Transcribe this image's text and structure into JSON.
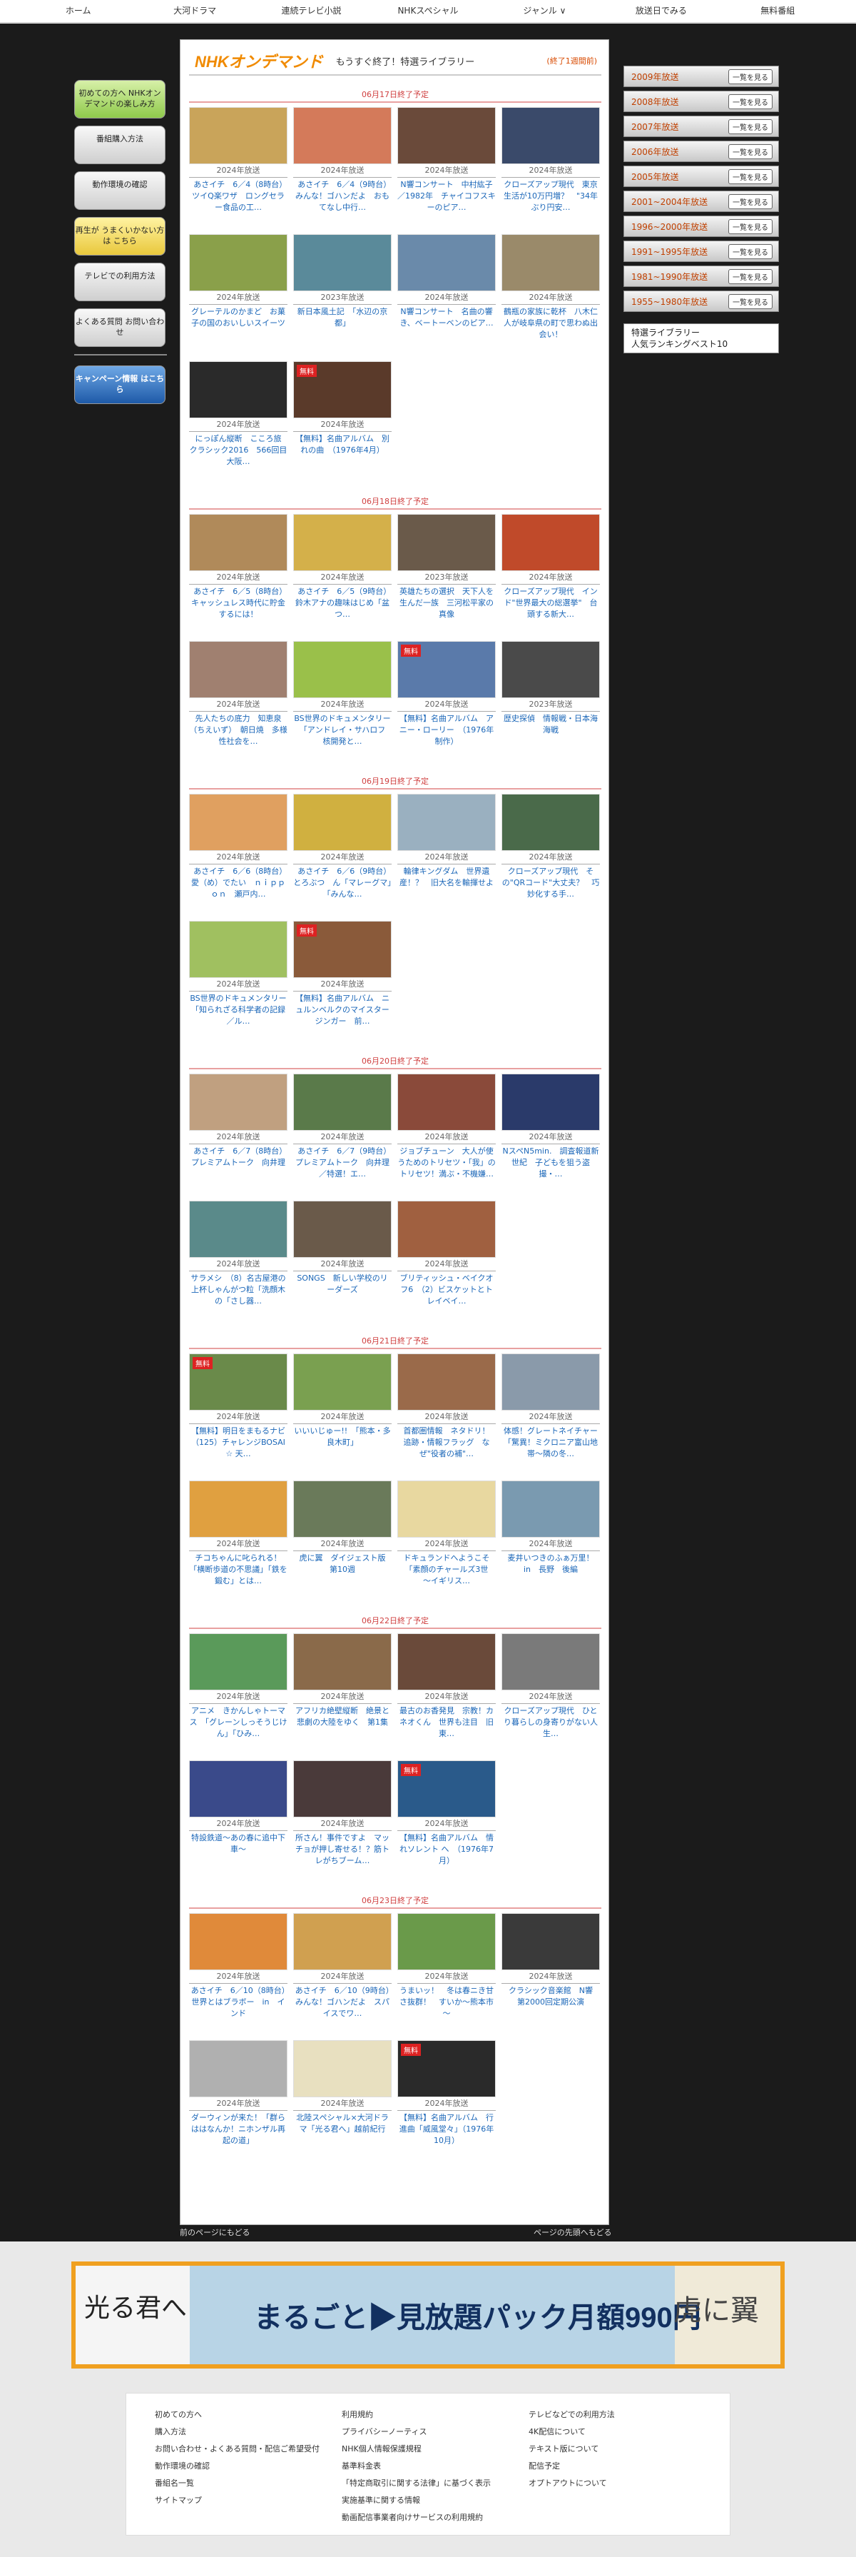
{
  "topnav": [
    "ホーム",
    "大河ドラマ",
    "連続テレビ小説",
    "NHKスペシャル",
    "ジャンル ∨",
    "放送日でみる",
    "無料番組"
  ],
  "header": {
    "logo": "NHKオンデマンド",
    "title": "もうすぐ終了！特選ライブラリー",
    "endlink": "(終了1週間前)"
  },
  "leftnav": [
    "初めての方へ NHKオンデマンドの楽しみ方",
    "番組購入方法",
    "動作環境の確認",
    "再生が うまくいかない方は こちら",
    "テレビでの利用方法",
    "よくある質問 お問い合わせ",
    "キャンペーン情報 はこちら"
  ],
  "sections": [
    {
      "label": "06月17日終了予定",
      "tiles": [
        {
          "year": "2024年放送",
          "title": "あさイチ　6／4（8時台）　ツイQ楽ワザ　ロングセラー食品の工…",
          "color": "#c9a45a"
        },
        {
          "year": "2024年放送",
          "title": "あさイチ　6／4（9時台）　みんな！ゴハンだよ　おもてなし中行…",
          "color": "#d47a5a"
        },
        {
          "year": "2024年放送",
          "title": "N響コンサート　中村紘子／1982年　チャイコフスキーのピア…",
          "color": "#6a4a3a"
        },
        {
          "year": "2024年放送",
          "title": "クローズアップ現代　東京生活が10万円増？　\"34年ぶり円安…",
          "color": "#3a4a6a"
        },
        {
          "year": "2024年放送",
          "title": "グレーテルのかまど　お菓子の国のおいしいスイーツ",
          "color": "#8aa04a"
        },
        {
          "year": "2023年放送",
          "title": "新日本風土記　「水辺の京都」",
          "color": "#5a8a9a"
        },
        {
          "year": "2024年放送",
          "title": "N響コンサート　名曲の響き、ベートーベンのピア…",
          "color": "#6a8aaa"
        },
        {
          "year": "2024年放送",
          "title": "鶴瓶の家族に乾杯　八木仁人が岐阜県の町で思わぬ出会い！",
          "color": "#9a8a6a"
        },
        {
          "year": "2024年放送",
          "title": "にっぽん縦断　こころ旅　クラシック2016　566回目　大阪…",
          "color": "#2a2a2a"
        },
        {
          "year": "2024年放送",
          "title": "【無料】名曲アルバム　別れの曲　（1976年4月）",
          "color": "#5a3a2a"
        }
      ]
    },
    {
      "label": "06月18日終了予定",
      "tiles": [
        {
          "year": "2024年放送",
          "title": "あさイチ　6／5（8時台）　キャッシュレス時代に貯金するには！",
          "color": "#b08a5a"
        },
        {
          "year": "2024年放送",
          "title": "あさイチ　6／5（9時台）　鈴木アナの趣味はじめ「盆つ…",
          "color": "#d4b04a"
        },
        {
          "year": "2023年放送",
          "title": "英雄たちの選択　天下人を生んだ一族　三河松平家の真像",
          "color": "#6a5a4a"
        },
        {
          "year": "2024年放送",
          "title": "クローズアップ現代　インド\"世界最大の総選挙\"　台頭する新大…",
          "color": "#c04a2a"
        },
        {
          "year": "2024年放送",
          "title": "先人たちの底力　知恵泉（ちえいず）　朝日焼　多様性社会を…",
          "color": "#a08070"
        },
        {
          "year": "2024年放送",
          "title": "BS世界のドキュメンタリー　「アンドレイ・サハロフ　核開発と…",
          "color": "#9ac04a"
        },
        {
          "year": "2024年放送",
          "title": "【無料】名曲アルバム　アニー・ローリー　（1976年制作）",
          "color": "#5a7aaa"
        },
        {
          "year": "2023年放送",
          "title": "歴史探偵　情報戦・日本海海戦",
          "color": "#4a4a4a"
        }
      ]
    },
    {
      "label": "06月19日終了予定",
      "tiles": [
        {
          "year": "2024年放送",
          "title": "あさイチ　6／6（8時台）　愛（め）でたい　ｎｉｐｐｏｎ　瀬戸内…",
          "color": "#e0a060"
        },
        {
          "year": "2024年放送",
          "title": "あさイチ　6／6（9時台）　とろぶつ　ん「マレーグマ」「みんな…",
          "color": "#d0b040"
        },
        {
          "year": "2024年放送",
          "title": "輪律キングダム　世界遺産！？　旧大名を輸揮せよ",
          "color": "#9ab0c0"
        },
        {
          "year": "2024年放送",
          "title": "クローズアップ現代　その\"QRコード\"大丈夫？　巧妙化する手…",
          "color": "#4a6a4a"
        },
        {
          "year": "2024年放送",
          "title": "BS世界のドキュメンタリー　「知られざる科学者の記録　／ル…",
          "color": "#a0c060"
        },
        {
          "year": "2024年放送",
          "title": "【無料】名曲アルバム　ニュルンベルクのマイスタージンガー　前…",
          "color": "#8a5a3a"
        }
      ]
    },
    {
      "label": "06月20日終了予定",
      "tiles": [
        {
          "year": "2024年放送",
          "title": "あさイチ　6／7（8時台）　プレミアムトーク　向井理",
          "color": "#c0a080"
        },
        {
          "year": "2024年放送",
          "title": "あさイチ　6／7（9時台）　プレミアムトーク　向井理／特選！エ…",
          "color": "#5a7a4a"
        },
        {
          "year": "2024年放送",
          "title": "ジョブチューン　大人が使うためのトリセツ・「我」のトリセツ！満ぶ・不機嫌…",
          "color": "#8a4a3a"
        },
        {
          "year": "2024年放送",
          "title": "NスペN5min.　調査報道新世紀　子どもを狙う盗撮・…",
          "color": "#2a3a6a"
        },
        {
          "year": "2024年放送",
          "title": "サラメシ　（8）名古屋港の上杯しゃんがつ粒「洗顔木の「さし器…",
          "color": "#5a8a8a"
        },
        {
          "year": "2024年放送",
          "title": "SONGS　新しい学校のリーダーズ",
          "color": "#6a5a4a"
        },
        {
          "year": "2024年放送",
          "title": "ブリティッシュ・ベイクオフ6　（2）ビスケットとトレイベイ…",
          "color": "#a06040"
        }
      ]
    },
    {
      "label": "06月21日終了予定",
      "tiles": [
        {
          "year": "2024年放送",
          "title": "【無料】明日をまもるナビ（125）チャレンジBOSAI ☆ 天…",
          "color": "#6a8a4a"
        },
        {
          "year": "2024年放送",
          "title": "いいいじゅー!!　「熊本・多良木町」",
          "color": "#7aa050"
        },
        {
          "year": "2024年放送",
          "title": "首都圏情報　ネタドリ！　追跡・情報フラッグ　なぜ\"役者の補\"…",
          "color": "#9a6a4a"
        },
        {
          "year": "2024年放送",
          "title": "体感！グレートネイチャー　「驚異！ミクロニア富山地帯～隣の冬…",
          "color": "#8a9aaa"
        },
        {
          "year": "2024年放送",
          "title": "チコちゃんに叱られる！　「横断歩道の不思議」「鉄を鍛む」とは…",
          "color": "#e0a040"
        },
        {
          "year": "2024年放送",
          "title": "虎に翼　ダイジェスト版　第10週",
          "color": "#6a7a5a"
        },
        {
          "year": "2024年放送",
          "title": "ドキュランドへようこそ　「素顔のチャールズ3世　～イギリス…",
          "color": "#e8d8a0"
        },
        {
          "year": "2024年放送",
          "title": "麦井いつきのふぁ万里！　in　長野　後編",
          "color": "#7a9ab0"
        }
      ]
    },
    {
      "label": "06月22日終了予定",
      "tiles": [
        {
          "year": "2024年放送",
          "title": "アニメ　きかんしゃトーマス　「グレーンしっそうじけん」「ひみ…",
          "color": "#5a9a5a"
        },
        {
          "year": "2024年放送",
          "title": "アフリカ絶壁縦断　絶景と悲劇の大陸をゆく　第1集",
          "color": "#8a6a4a"
        },
        {
          "year": "2024年放送",
          "title": "最古のお香発見　宗教！カネオくん　世界も注目　旧東…",
          "color": "#6a4a3a"
        },
        {
          "year": "2024年放送",
          "title": "クローズアップ現代　ひとり暮らしの身寄りがない人生…",
          "color": "#7a7a7a"
        },
        {
          "year": "2024年放送",
          "title": "特設鉄道～あの春に追中下車～",
          "color": "#3a4a8a"
        },
        {
          "year": "2024年放送",
          "title": "所さん！事件ですよ　マッチョが押し寄せる！？筋トレがちブーム…",
          "color": "#4a3a3a"
        },
        {
          "year": "2024年放送",
          "title": "【無料】名曲アルバム　情れソレント へ　（1976年7月）",
          "color": "#2a5a8a"
        }
      ]
    },
    {
      "label": "06月23日終了予定",
      "tiles": [
        {
          "year": "2024年放送",
          "title": "あさイチ　6／10（8時台）　世界とはブラボー　in　インド",
          "color": "#e08a3a"
        },
        {
          "year": "2024年放送",
          "title": "あさイチ　6／10（9時台）　みんな！ゴハンだよ　スパイスでワ…",
          "color": "#d0a050"
        },
        {
          "year": "2024年放送",
          "title": "うまいッ！　冬は春ニき甘さ抜群！　すいか～熊本市～",
          "color": "#6a9a4a"
        },
        {
          "year": "2024年放送",
          "title": "クラシック音楽館　N響　第2000回定期公演",
          "color": "#3a3a3a"
        },
        {
          "year": "2024年放送",
          "title": "ダーウィンが来た！「群らははなんか！ニホンザル再起の道」",
          "color": "#b0b0b0"
        },
        {
          "year": "2024年放送",
          "title": "北陸スペシャル×大河ドラマ「光る君へ」越前紀行",
          "color": "#e8e0c0"
        },
        {
          "year": "2024年放送",
          "title": "【無料】名曲アルバム　行進曲「威風堂々」（1976年10月）",
          "color": "#2a2a2a"
        }
      ]
    }
  ],
  "footerbar": {
    "prev": "前のページにもどる",
    "top": "ページの先頭へもどる"
  },
  "years": [
    "2009年放送",
    "2008年放送",
    "2007年放送",
    "2006年放送",
    "2005年放送",
    "2001~2004年放送",
    "1996~2000年放送",
    "1991~1995年放送",
    "1981~1990年放送",
    "1955~1980年放送"
  ],
  "yearbtn": "一覧を見る",
  "ranking": "特選ライブラリー\n人気ランキングベスト10",
  "banner": {
    "left": "光る君へ",
    "text": "まるごと▶見放題パック月額990円",
    "right": "虎に翼"
  },
  "footer": [
    [
      "初めての方へ",
      "購入方法",
      "お問い合わせ・よくある質問・配信ご希望受付",
      "動作環境の確認",
      "番組名一覧",
      "サイトマップ"
    ],
    [
      "利用規約",
      "プライバシーノーティス",
      "NHK個人情報保護規程",
      "基準料金表",
      "「特定商取引に関する法律」に基づく表示",
      "実施基準に関する情報",
      "動画配信事業者向けサービスの利用規約"
    ],
    [
      "テレビなどでの利用方法",
      "4K配信について",
      "テキスト版について",
      "配信予定",
      "オプトアウトについて"
    ]
  ]
}
